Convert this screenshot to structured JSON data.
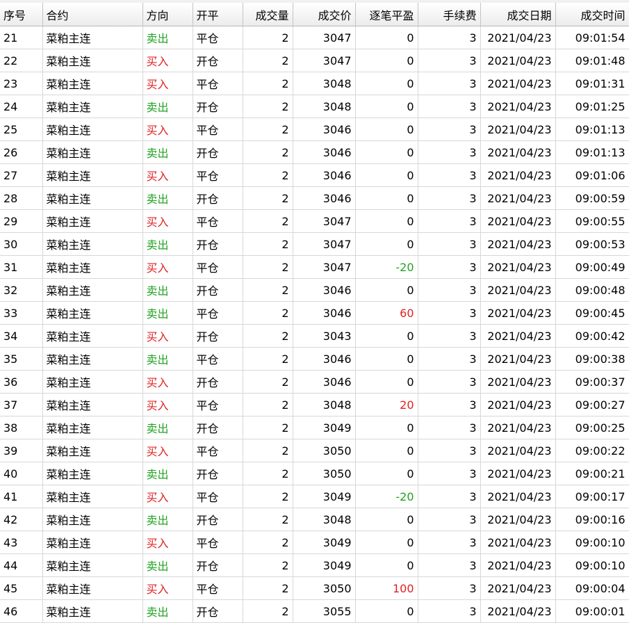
{
  "colors": {
    "buy": "#e02020",
    "sell": "#22a322",
    "profit": "#e02020",
    "loss": "#22a322"
  },
  "header": {
    "seq": "序号",
    "contract": "合约",
    "direction": "方向",
    "offset": "开平",
    "volume": "成交量",
    "price": "成交价",
    "pnl": "逐笔平盈",
    "fee": "手续费",
    "date": "成交日期",
    "time": "成交时间"
  },
  "rows": [
    {
      "seq": "21",
      "contract": "菜粕主连",
      "direction": "卖出",
      "offset": "平仓",
      "volume": "2",
      "price": "3047",
      "pnl": "0",
      "fee": "3",
      "date": "2021/04/23",
      "time": "09:01:54"
    },
    {
      "seq": "22",
      "contract": "菜粕主连",
      "direction": "买入",
      "offset": "开仓",
      "volume": "2",
      "price": "3047",
      "pnl": "0",
      "fee": "3",
      "date": "2021/04/23",
      "time": "09:01:48"
    },
    {
      "seq": "23",
      "contract": "菜粕主连",
      "direction": "买入",
      "offset": "平仓",
      "volume": "2",
      "price": "3048",
      "pnl": "0",
      "fee": "3",
      "date": "2021/04/23",
      "time": "09:01:31"
    },
    {
      "seq": "24",
      "contract": "菜粕主连",
      "direction": "卖出",
      "offset": "开仓",
      "volume": "2",
      "price": "3048",
      "pnl": "0",
      "fee": "3",
      "date": "2021/04/23",
      "time": "09:01:25"
    },
    {
      "seq": "25",
      "contract": "菜粕主连",
      "direction": "买入",
      "offset": "平仓",
      "volume": "2",
      "price": "3046",
      "pnl": "0",
      "fee": "3",
      "date": "2021/04/23",
      "time": "09:01:13"
    },
    {
      "seq": "26",
      "contract": "菜粕主连",
      "direction": "卖出",
      "offset": "开仓",
      "volume": "2",
      "price": "3046",
      "pnl": "0",
      "fee": "3",
      "date": "2021/04/23",
      "time": "09:01:13"
    },
    {
      "seq": "27",
      "contract": "菜粕主连",
      "direction": "买入",
      "offset": "平仓",
      "volume": "2",
      "price": "3046",
      "pnl": "0",
      "fee": "3",
      "date": "2021/04/23",
      "time": "09:01:06"
    },
    {
      "seq": "28",
      "contract": "菜粕主连",
      "direction": "卖出",
      "offset": "开仓",
      "volume": "2",
      "price": "3046",
      "pnl": "0",
      "fee": "3",
      "date": "2021/04/23",
      "time": "09:00:59"
    },
    {
      "seq": "29",
      "contract": "菜粕主连",
      "direction": "买入",
      "offset": "平仓",
      "volume": "2",
      "price": "3047",
      "pnl": "0",
      "fee": "3",
      "date": "2021/04/23",
      "time": "09:00:55"
    },
    {
      "seq": "30",
      "contract": "菜粕主连",
      "direction": "卖出",
      "offset": "开仓",
      "volume": "2",
      "price": "3047",
      "pnl": "0",
      "fee": "3",
      "date": "2021/04/23",
      "time": "09:00:53"
    },
    {
      "seq": "31",
      "contract": "菜粕主连",
      "direction": "买入",
      "offset": "平仓",
      "volume": "2",
      "price": "3047",
      "pnl": "-20",
      "fee": "3",
      "date": "2021/04/23",
      "time": "09:00:49"
    },
    {
      "seq": "32",
      "contract": "菜粕主连",
      "direction": "卖出",
      "offset": "开仓",
      "volume": "2",
      "price": "3046",
      "pnl": "0",
      "fee": "3",
      "date": "2021/04/23",
      "time": "09:00:48"
    },
    {
      "seq": "33",
      "contract": "菜粕主连",
      "direction": "卖出",
      "offset": "平仓",
      "volume": "2",
      "price": "3046",
      "pnl": "60",
      "fee": "3",
      "date": "2021/04/23",
      "time": "09:00:45"
    },
    {
      "seq": "34",
      "contract": "菜粕主连",
      "direction": "买入",
      "offset": "开仓",
      "volume": "2",
      "price": "3043",
      "pnl": "0",
      "fee": "3",
      "date": "2021/04/23",
      "time": "09:00:42"
    },
    {
      "seq": "35",
      "contract": "菜粕主连",
      "direction": "卖出",
      "offset": "平仓",
      "volume": "2",
      "price": "3046",
      "pnl": "0",
      "fee": "3",
      "date": "2021/04/23",
      "time": "09:00:38"
    },
    {
      "seq": "36",
      "contract": "菜粕主连",
      "direction": "买入",
      "offset": "开仓",
      "volume": "2",
      "price": "3046",
      "pnl": "0",
      "fee": "3",
      "date": "2021/04/23",
      "time": "09:00:37"
    },
    {
      "seq": "37",
      "contract": "菜粕主连",
      "direction": "买入",
      "offset": "平仓",
      "volume": "2",
      "price": "3048",
      "pnl": "20",
      "fee": "3",
      "date": "2021/04/23",
      "time": "09:00:27"
    },
    {
      "seq": "38",
      "contract": "菜粕主连",
      "direction": "卖出",
      "offset": "开仓",
      "volume": "2",
      "price": "3049",
      "pnl": "0",
      "fee": "3",
      "date": "2021/04/23",
      "time": "09:00:25"
    },
    {
      "seq": "39",
      "contract": "菜粕主连",
      "direction": "买入",
      "offset": "平仓",
      "volume": "2",
      "price": "3050",
      "pnl": "0",
      "fee": "3",
      "date": "2021/04/23",
      "time": "09:00:22"
    },
    {
      "seq": "40",
      "contract": "菜粕主连",
      "direction": "卖出",
      "offset": "开仓",
      "volume": "2",
      "price": "3050",
      "pnl": "0",
      "fee": "3",
      "date": "2021/04/23",
      "time": "09:00:21"
    },
    {
      "seq": "41",
      "contract": "菜粕主连",
      "direction": "买入",
      "offset": "平仓",
      "volume": "2",
      "price": "3049",
      "pnl": "-20",
      "fee": "3",
      "date": "2021/04/23",
      "time": "09:00:17"
    },
    {
      "seq": "42",
      "contract": "菜粕主连",
      "direction": "卖出",
      "offset": "开仓",
      "volume": "2",
      "price": "3048",
      "pnl": "0",
      "fee": "3",
      "date": "2021/04/23",
      "time": "09:00:16"
    },
    {
      "seq": "43",
      "contract": "菜粕主连",
      "direction": "买入",
      "offset": "平仓",
      "volume": "2",
      "price": "3049",
      "pnl": "0",
      "fee": "3",
      "date": "2021/04/23",
      "time": "09:00:10"
    },
    {
      "seq": "44",
      "contract": "菜粕主连",
      "direction": "卖出",
      "offset": "开仓",
      "volume": "2",
      "price": "3049",
      "pnl": "0",
      "fee": "3",
      "date": "2021/04/23",
      "time": "09:00:10"
    },
    {
      "seq": "45",
      "contract": "菜粕主连",
      "direction": "买入",
      "offset": "平仓",
      "volume": "2",
      "price": "3050",
      "pnl": "100",
      "fee": "3",
      "date": "2021/04/23",
      "time": "09:00:04"
    },
    {
      "seq": "46",
      "contract": "菜粕主连",
      "direction": "卖出",
      "offset": "开仓",
      "volume": "2",
      "price": "3055",
      "pnl": "0",
      "fee": "3",
      "date": "2021/04/23",
      "time": "09:00:01"
    }
  ]
}
